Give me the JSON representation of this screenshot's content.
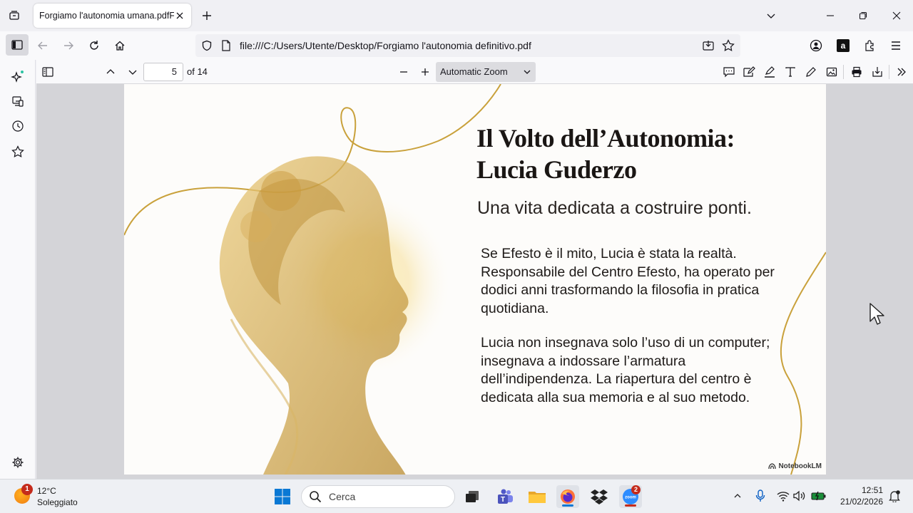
{
  "browser": {
    "tab_title": "Forgiamo l'autonomia umana.pdfFo",
    "url": "file:///C:/Users/Utente/Desktop/Forgiamo l'autonomia definitivo.pdf"
  },
  "pdf_toolbar": {
    "page_number": "5",
    "page_count": "of 14",
    "zoom": "Automatic Zoom"
  },
  "slide": {
    "title_line1": "Il Volto dell’Autonomia:",
    "title_line2": "Lucia Guderzo",
    "subtitle": "Una vita dedicata a costruire ponti.",
    "paragraph1": "Se Efesto è il mito, Lucia è stata la realtà. Responsabile del Centro Efesto, ha operato per dodici anni trasformando la filosofia in pratica quotidiana.",
    "paragraph2": "Lucia non insegnava solo l’uso di un computer; insegnava a indossare l’armatura dell’indipendenza. La riapertura del centro è dedicata alla sua memoria e al suo metodo.",
    "badge": "NotebookLM"
  },
  "taskbar": {
    "weather_temp": "12°C",
    "weather_desc": "Soleggiato",
    "weather_badge": "1",
    "search_placeholder": "Cerca",
    "zoom_badge": "2",
    "time": "12:51",
    "date": "21/02/2026"
  },
  "colors": {
    "accent_gold": "#c9a13b",
    "browser_bg": "#f0f0f4",
    "page_bg": "#fdfcfa"
  }
}
